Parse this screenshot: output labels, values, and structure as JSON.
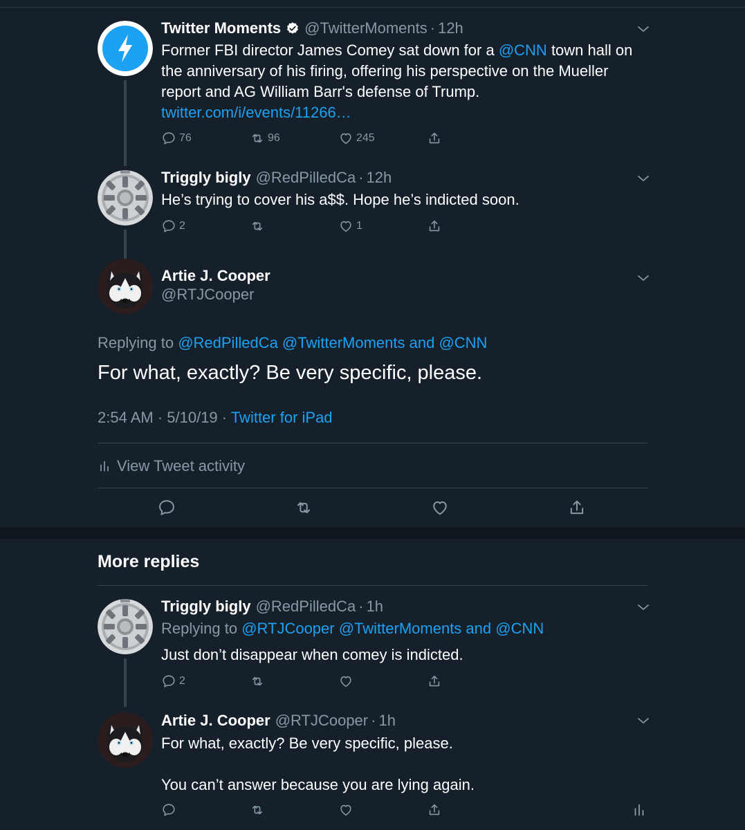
{
  "tweets": [
    {
      "name": "Twitter Moments",
      "handle": "@TwitterMoments",
      "time": "12h",
      "text_1": "Former FBI director James Comey sat down for a ",
      "link_1": "@CNN",
      "text_2": " town hall on the anniversary of his firing, offering his perspective on the Mueller report and AG William Barr's defense of Trump. ",
      "link_2": "twitter.com/i/events/11266…",
      "replies": "76",
      "retweets": "96",
      "likes": "245"
    },
    {
      "name": "Triggly bigly",
      "handle": "@RedPilledCa",
      "time": "12h",
      "text": "He’s trying to cover his a$$. Hope he’s indicted soon.",
      "replies": "2",
      "likes": "1"
    }
  ],
  "focused": {
    "name": "Artie J. Cooper",
    "handle": "@RTJCooper",
    "replying_prefix": "Replying to ",
    "replying_links": "@RedPilledCa @TwitterMoments and @CNN",
    "text": "For what, exactly? Be very specific, please.",
    "datetime": "2:54 AM · 5/10/19 · ",
    "client": "Twitter for iPad",
    "activity_label": "View Tweet activity"
  },
  "more_replies": {
    "heading": "More replies",
    "items": [
      {
        "name": "Triggly bigly",
        "handle": "@RedPilledCa",
        "time": "1h",
        "replying_prefix": "Replying to ",
        "replying_links": "@RTJCooper @TwitterMoments and @CNN",
        "text": "Just don’t disappear when comey is indicted.",
        "replies": "2"
      },
      {
        "name": "Artie J. Cooper",
        "handle": "@RTJCooper",
        "time": "1h",
        "text_1": "For what, exactly? Be very specific, please.",
        "text_2": "You can’t answer because you are lying again."
      }
    ]
  },
  "separator": "·",
  "colors": {
    "background": "#15202b",
    "accent": "#1da1f2",
    "muted": "#8899a6",
    "border": "#38444d"
  },
  "icons": [
    "chevron-down-icon",
    "reply-icon",
    "retweet-icon",
    "like-icon",
    "share-icon",
    "activity-icon",
    "verified-badge-icon",
    "lightning-icon"
  ]
}
